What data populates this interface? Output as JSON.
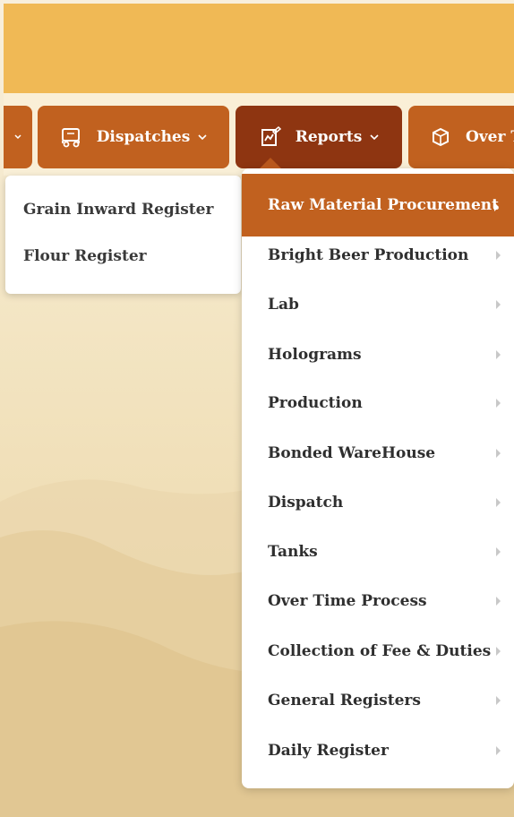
{
  "nav": {
    "items": [
      {
        "label": "Dispatches",
        "icon": "truck-icon"
      },
      {
        "label": "Reports",
        "icon": "chart-edit-icon"
      },
      {
        "label": "Over T",
        "icon": "box-icon"
      }
    ]
  },
  "submenu": {
    "items": [
      "Grain Inward Register",
      "Flour Register"
    ]
  },
  "reports_menu": {
    "items": [
      {
        "label": "Raw Material Procurement",
        "active": true
      },
      {
        "label": "Bright Beer Production"
      },
      {
        "label": "Lab"
      },
      {
        "label": "Holograms"
      },
      {
        "label": "Production"
      },
      {
        "label": "Bonded WareHouse"
      },
      {
        "label": "Dispatch"
      },
      {
        "label": "Tanks"
      },
      {
        "label": "Over Time Process"
      },
      {
        "label": "Collection of Fee & Duties"
      },
      {
        "label": "General Registers"
      },
      {
        "label": "Daily Register"
      }
    ]
  },
  "colors": {
    "topbar": "#f0b955",
    "nav_button": "#c1611f",
    "nav_button_active": "#8e3511",
    "menu_active": "#c1611f"
  }
}
